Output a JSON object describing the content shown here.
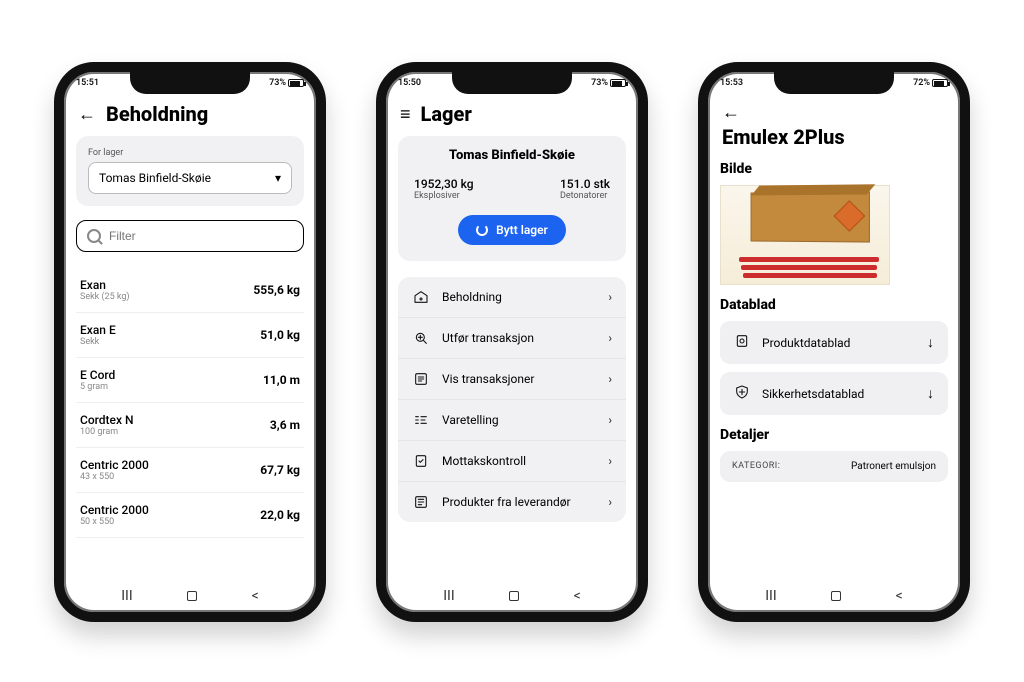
{
  "phone1": {
    "time": "15:51",
    "battery": "73%",
    "title": "Beholdning",
    "card_label": "For lager",
    "selected_storage": "Tomas Binfield-Skøie",
    "filter_placeholder": "Filter",
    "items": [
      {
        "name": "Exan",
        "sub": "Sekk (25 kg)",
        "value": "555,6 kg"
      },
      {
        "name": "Exan E",
        "sub": "Sekk",
        "value": "51,0 kg"
      },
      {
        "name": "E Cord",
        "sub": "5 gram",
        "value": "11,0 m"
      },
      {
        "name": "Cordtex N",
        "sub": "100 gram",
        "value": "3,6 m"
      },
      {
        "name": "Centric 2000",
        "sub": "43 x 550",
        "value": "67,7 kg"
      },
      {
        "name": "Centric 2000",
        "sub": "50 x 550",
        "value": "22,0 kg"
      }
    ]
  },
  "phone2": {
    "time": "15:50",
    "battery": "73%",
    "title": "Lager",
    "storage_name": "Tomas Binfield-Skøie",
    "stat1_value": "1952,30 kg",
    "stat1_label": "Eksplosiver",
    "stat2_value": "151.0 stk",
    "stat2_label": "Detonatorer",
    "switch_label": "Bytt lager",
    "menu": [
      "Beholdning",
      "Utfør transaksjon",
      "Vis transaksjoner",
      "Varetelling",
      "Mottakskontroll",
      "Produkter fra leverandør"
    ]
  },
  "phone3": {
    "time": "15:53",
    "battery": "72%",
    "title": "Emulex 2Plus",
    "section_image": "Bilde",
    "section_datasheet": "Datablad",
    "doc1": "Produktdatablad",
    "doc2": "Sikkerhetsdatablad",
    "section_details": "Detaljer",
    "detail_key": "KATEGORI:",
    "detail_value": "Patronert emulsjon"
  }
}
